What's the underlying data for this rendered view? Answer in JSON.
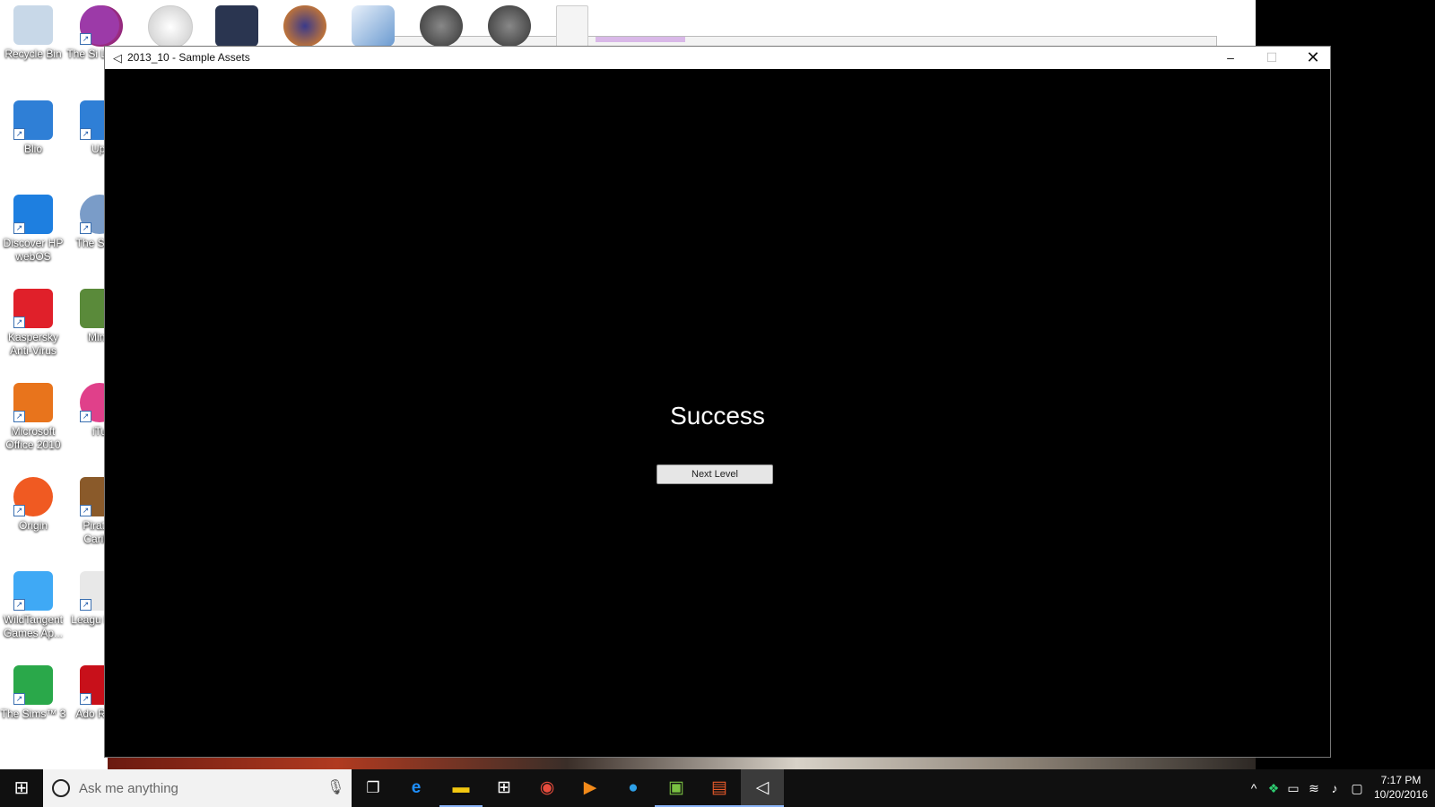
{
  "window": {
    "title": "2013_10 - Sample Assets",
    "minimize_glyph": "–",
    "maximize_glyph": "☐",
    "close_glyph": "✕"
  },
  "game": {
    "status_text": "Success",
    "next_button_label": "Next Level"
  },
  "desktop_icons": [
    {
      "label": "Recycle Bin",
      "icon": "recycle-bin-icon",
      "color": "#c8d8e8"
    },
    {
      "label": "Blio",
      "icon": "blio-icon",
      "color": "#2f7fd6"
    },
    {
      "label": "Discover HP webOS",
      "icon": "hp-webos-icon",
      "color": "#1e7fe0"
    },
    {
      "label": "Kaspersky Anti-Virus",
      "icon": "kaspersky-icon",
      "color": "#e0202a"
    },
    {
      "label": "Microsoft Office 2010",
      "icon": "office-icon",
      "color": "#e8741c"
    },
    {
      "label": "Origin",
      "icon": "origin-icon",
      "color": "#f05a22"
    },
    {
      "label": "WildTangent Games Ap...",
      "icon": "wildtangent-icon",
      "color": "#3fa9f5"
    },
    {
      "label": "The Sims™ 3",
      "icon": "sims3-icon",
      "color": "#2aa84a"
    }
  ],
  "desktop_icons_col2": [
    {
      "label": "The Si Late N",
      "icon": "sims-late-night-icon",
      "color": "#9c3aa8"
    },
    {
      "label": "Upl",
      "icon": "uplay-icon",
      "color": "#2f7fd6"
    },
    {
      "label": "The Si Pe",
      "icon": "sims-pets-icon",
      "color": "#7a9cc8"
    },
    {
      "label": "Mine",
      "icon": "minecraft-icon",
      "color": "#5a8a3a"
    },
    {
      "label": "iTu",
      "icon": "itunes-icon",
      "color": "#e0408a"
    },
    {
      "label": "Pirates Caribb",
      "icon": "pirates-icon",
      "color": "#8a5a2a"
    },
    {
      "label": "Leagu Lege",
      "icon": "league-icon",
      "color": "#e8e8e8"
    },
    {
      "label": "Ado Read",
      "icon": "adobe-reader-icon",
      "color": "#c8101a"
    }
  ],
  "taskbar": {
    "search_placeholder": "Ask me anything",
    "start_glyph": "⊞",
    "time": "7:17 PM",
    "date": "10/20/2016"
  }
}
